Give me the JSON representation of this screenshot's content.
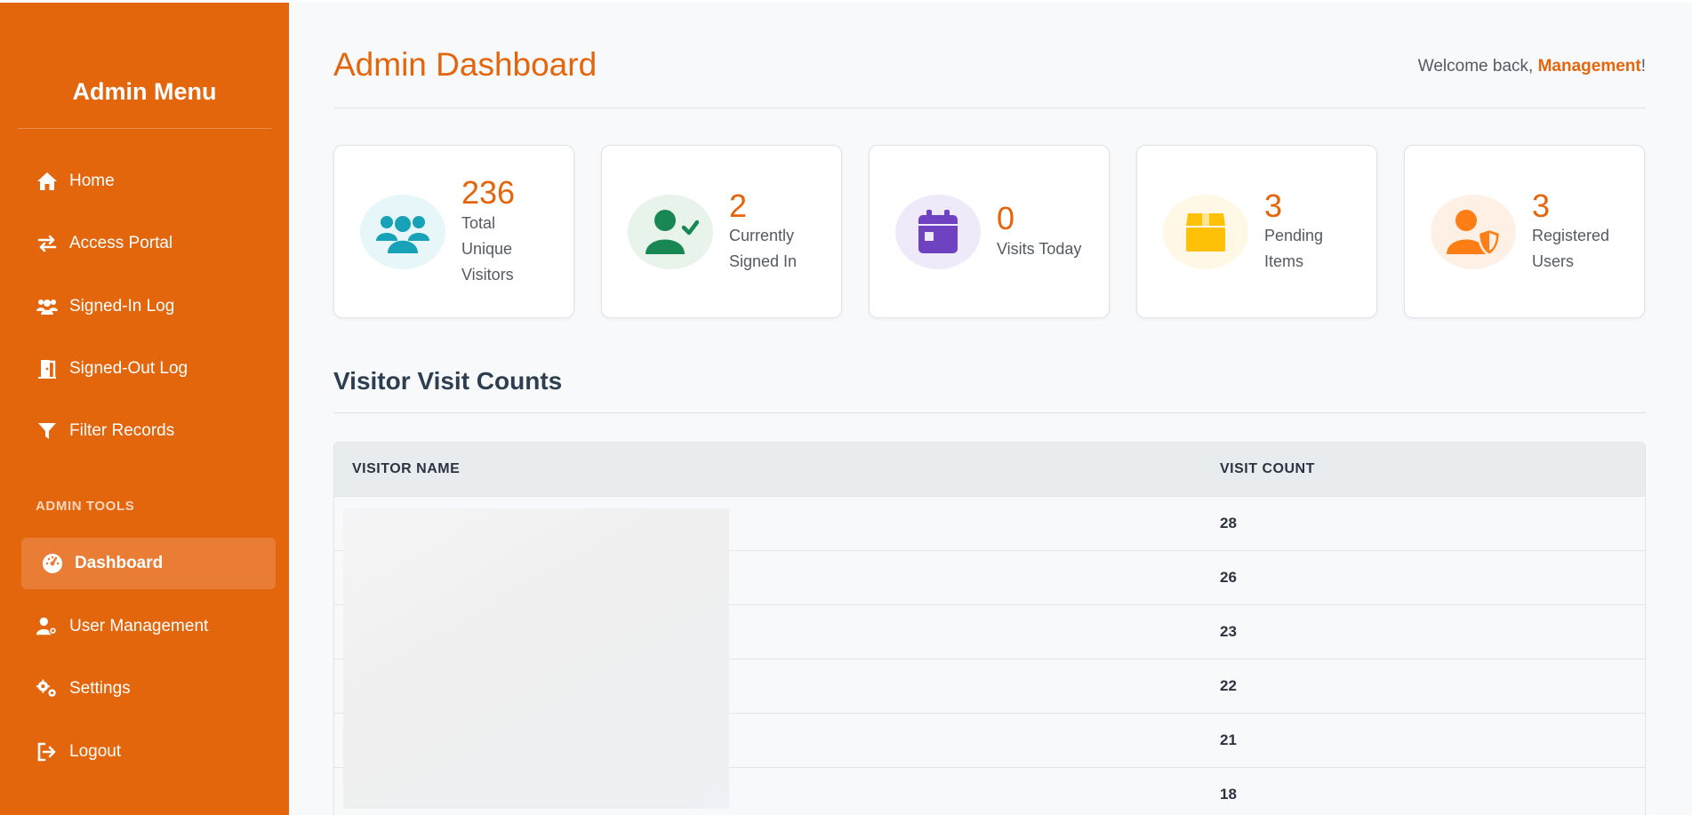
{
  "sidebar": {
    "title": "Admin Menu",
    "items": [
      {
        "label": "Home",
        "icon": "house-icon"
      },
      {
        "label": "Access Portal",
        "icon": "arrows-exchange-icon"
      },
      {
        "label": "Signed-In Log",
        "icon": "users-icon"
      },
      {
        "label": "Signed-Out Log",
        "icon": "door-exit-icon"
      },
      {
        "label": "Filter Records",
        "icon": "filter-icon"
      }
    ],
    "section_label": "ADMIN TOOLS",
    "admin_items": [
      {
        "label": "Dashboard",
        "icon": "gauge-icon",
        "active": true
      },
      {
        "label": "User Management",
        "icon": "user-gear-icon"
      },
      {
        "label": "Settings",
        "icon": "gears-icon"
      },
      {
        "label": "Logout",
        "icon": "sign-out-icon"
      }
    ]
  },
  "header": {
    "title": "Admin Dashboard",
    "welcome_prefix": "Welcome back, ",
    "user_name": "Management",
    "welcome_suffix": "!"
  },
  "stats": [
    {
      "value": "236",
      "label": "Total Unique Visitors",
      "icon": "users-group-icon",
      "color": "#17a2b8"
    },
    {
      "value": "2",
      "label": "Currently Signed In",
      "icon": "user-check-icon",
      "color": "#198754"
    },
    {
      "value": "0",
      "label": "Visits Today",
      "icon": "calendar-icon",
      "color": "#6f42c1"
    },
    {
      "value": "3",
      "label": "Pending Items",
      "icon": "box-icon",
      "color": "#ffc107"
    },
    {
      "value": "3",
      "label": "Registered Users",
      "icon": "user-shield-icon",
      "color": "#fd7e14"
    }
  ],
  "visit_counts": {
    "title": "Visitor Visit Counts",
    "columns": [
      "VISITOR NAME",
      "VISIT COUNT"
    ],
    "rows": [
      {
        "name": "",
        "count": "28"
      },
      {
        "name": "",
        "count": "26"
      },
      {
        "name": "",
        "count": "23"
      },
      {
        "name": "",
        "count": "22"
      },
      {
        "name": "",
        "count": "21"
      },
      {
        "name": "",
        "count": "18"
      }
    ]
  },
  "colors": {
    "accent": "#e3650c",
    "sidebar_bg": "#e3650c",
    "active_bg": "#e97d36"
  }
}
